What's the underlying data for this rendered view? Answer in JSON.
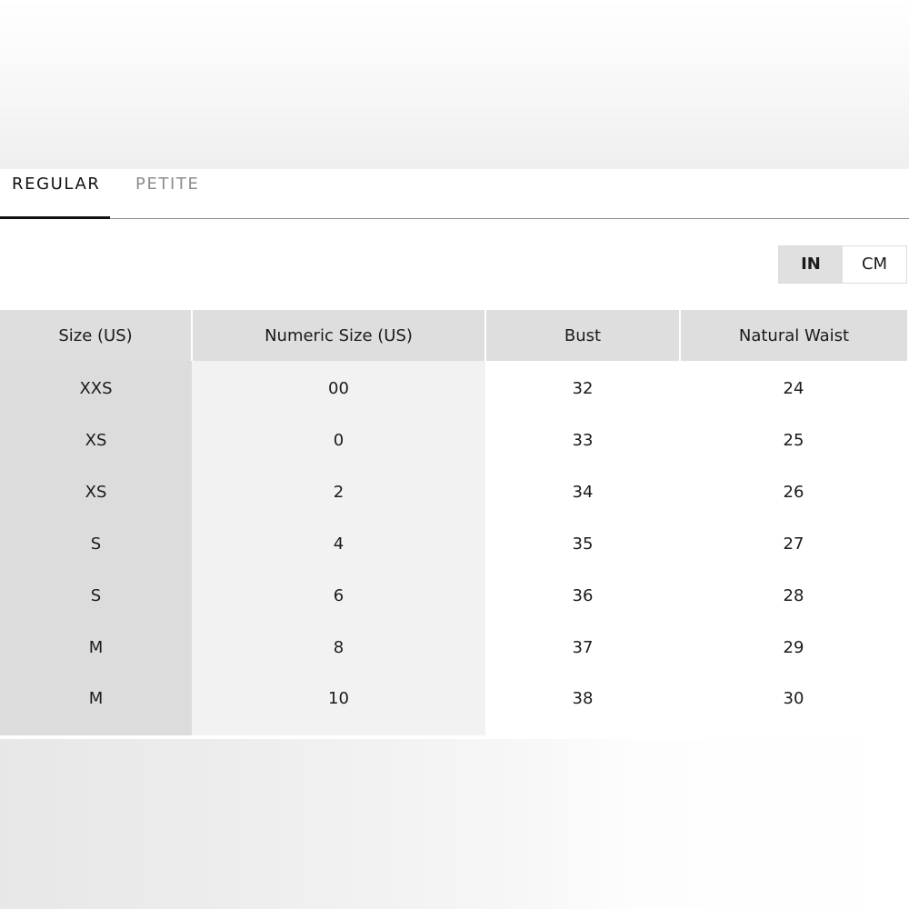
{
  "tabs": [
    {
      "label": "REGULAR",
      "active": true
    },
    {
      "label": "PETITE",
      "active": false
    }
  ],
  "units": {
    "in_label": "IN",
    "cm_label": "CM",
    "selected": "IN"
  },
  "table": {
    "headers": [
      "Size (US)",
      "Numeric Size (US)",
      "Bust",
      "Natural Waist"
    ],
    "rows": [
      [
        "XXS",
        "00",
        "32",
        "24"
      ],
      [
        "XS",
        "0",
        "33",
        "25"
      ],
      [
        "XS",
        "2",
        "34",
        "26"
      ],
      [
        "S",
        "4",
        "35",
        "27"
      ],
      [
        "S",
        "6",
        "36",
        "28"
      ],
      [
        "M",
        "8",
        "37",
        "29"
      ],
      [
        "M",
        "10",
        "38",
        "30"
      ]
    ]
  },
  "colors": {
    "active_tab": "#111111",
    "inactive_tab": "#8c8c8c",
    "header_bg": "#dedede",
    "first_column_bg": "#dcdcdc",
    "second_column_bg": "#f2f2f2",
    "selected_unit_bg": "#e0e0e0"
  }
}
